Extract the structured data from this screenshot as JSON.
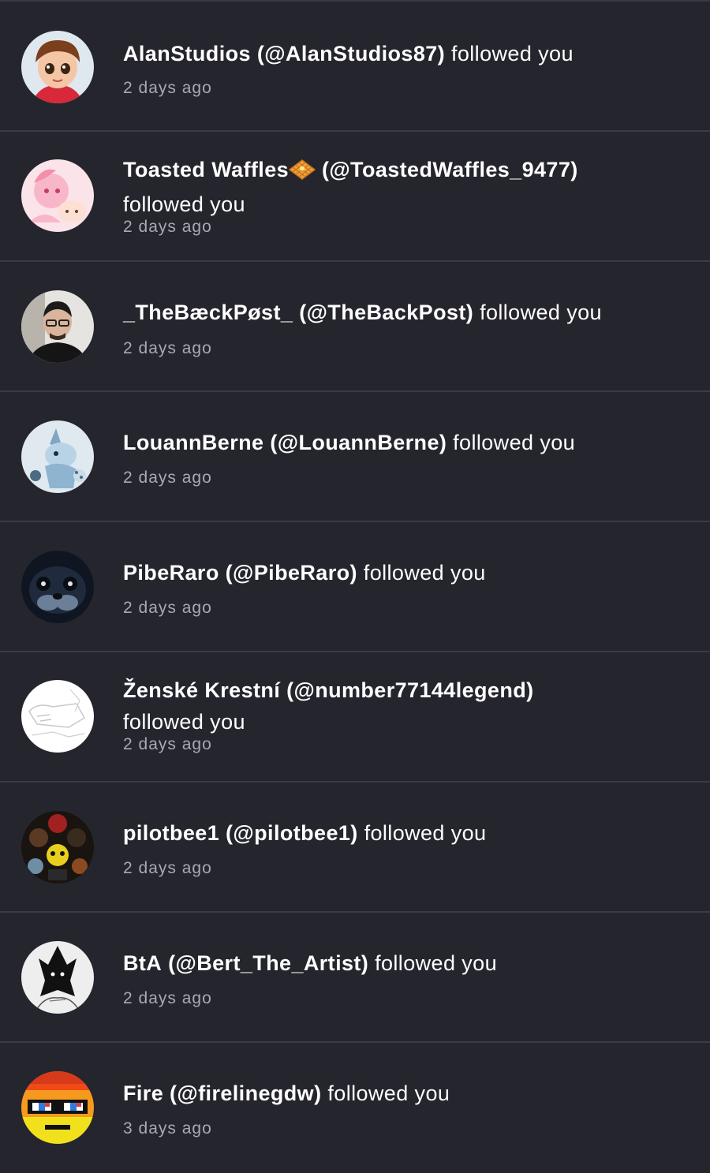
{
  "notifications": [
    {
      "name": "AlanStudios",
      "handle": "(@AlanStudios87)",
      "action": "followed you",
      "time": "2 days ago",
      "avatar": "cartoon-boy-avatar"
    },
    {
      "name": "Toasted Waffles",
      "handle": "(@ToastedWaffles_9477)",
      "action": "followed you",
      "time": "2 days ago",
      "avatar": "pink-character-avatar",
      "emoji": "waffle-icon"
    },
    {
      "name": "_TheBæckPøst_",
      "handle": "(@TheBackPost)",
      "action": "followed you",
      "time": "2 days ago",
      "avatar": "photo-person-avatar"
    },
    {
      "name": "LouannBerne",
      "handle": "(@LouannBerne)",
      "action": "followed you",
      "time": "2 days ago",
      "avatar": "blue-creature-avatar"
    },
    {
      "name": "PibeRaro",
      "handle": "(@PibeRaro)",
      "action": "followed you",
      "time": "2 days ago",
      "avatar": "dark-animatronic-avatar"
    },
    {
      "name": "Ženské Krestní",
      "handle": "(@number77144legend)",
      "action": "followed you",
      "time": "2 days ago",
      "avatar": "sketch-avatar"
    },
    {
      "name": "pilotbee1",
      "handle": "(@pilotbee1)",
      "action": "followed you",
      "time": "2 days ago",
      "avatar": "group-characters-avatar"
    },
    {
      "name": "BtA",
      "handle": "(@Bert_The_Artist)",
      "action": "followed you",
      "time": "2 days ago",
      "avatar": "sketch-figure-avatar"
    },
    {
      "name": "Fire",
      "handle": "(@firelinegdw)",
      "action": "followed you",
      "time": "3 days ago",
      "avatar": "pixel-face-avatar"
    }
  ],
  "colors": {
    "background": "#25252e",
    "divider": "#3b3b45",
    "text": "#ffffff",
    "muted": "#a9a9b3"
  }
}
